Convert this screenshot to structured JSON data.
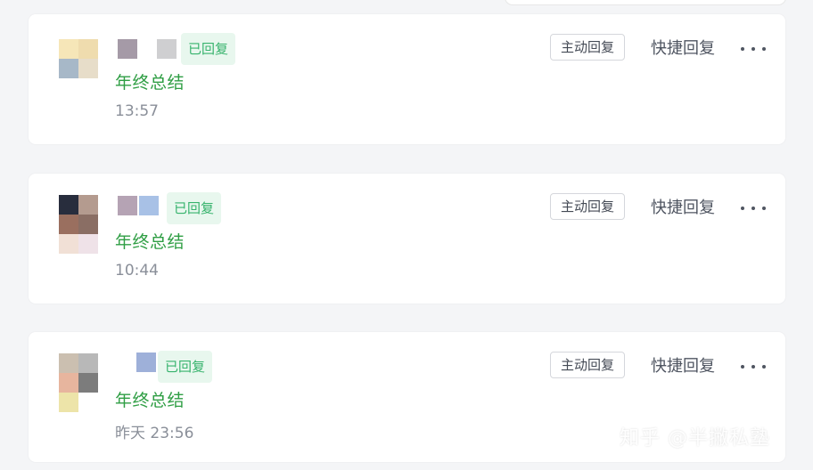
{
  "messages": [
    {
      "status": "已回复",
      "topic": "年终总结",
      "time": "13:57",
      "active_reply_label": "主动回复",
      "quick_reply_label": "快捷回复",
      "more_icon": "more-horizontal-icon",
      "avatar_colors": [
        "#f6e6b8",
        "#efdcae",
        "#a7b8c8",
        "#e7ddc9"
      ],
      "name_colors": [
        "#a59aa7",
        "#cfcfd1"
      ]
    },
    {
      "status": "已回复",
      "topic": "年终总结",
      "time": "10:44",
      "active_reply_label": "主动回复",
      "quick_reply_label": "快捷回复",
      "more_icon": "more-horizontal-icon",
      "avatar_colors": [
        "#282d3d",
        "#b49b8f",
        "#9a6f5f",
        "#8a6e64",
        "#f1e0d6",
        "#efe2e8"
      ],
      "name_colors": [
        "#b5a3b4",
        "#a8c1e6"
      ]
    },
    {
      "status": "已回复",
      "topic": "年终总结",
      "time": "昨天 23:56",
      "active_reply_label": "主动回复",
      "quick_reply_label": "快捷回复",
      "more_icon": "more-horizontal-icon",
      "avatar_colors": [
        "#cbbfb0",
        "#b8b8b8",
        "#e7b59e",
        "#7c7c7c",
        "#ede4a9",
        "#ffffff"
      ],
      "name_colors": [
        "#9eb0d9"
      ]
    }
  ],
  "watermark": "知乎 @半撇私塾",
  "colors": {
    "page_background": "#f4f5f7",
    "card_background": "#ffffff",
    "status_green": "#37b36d",
    "topic_green": "#2f9e44"
  }
}
